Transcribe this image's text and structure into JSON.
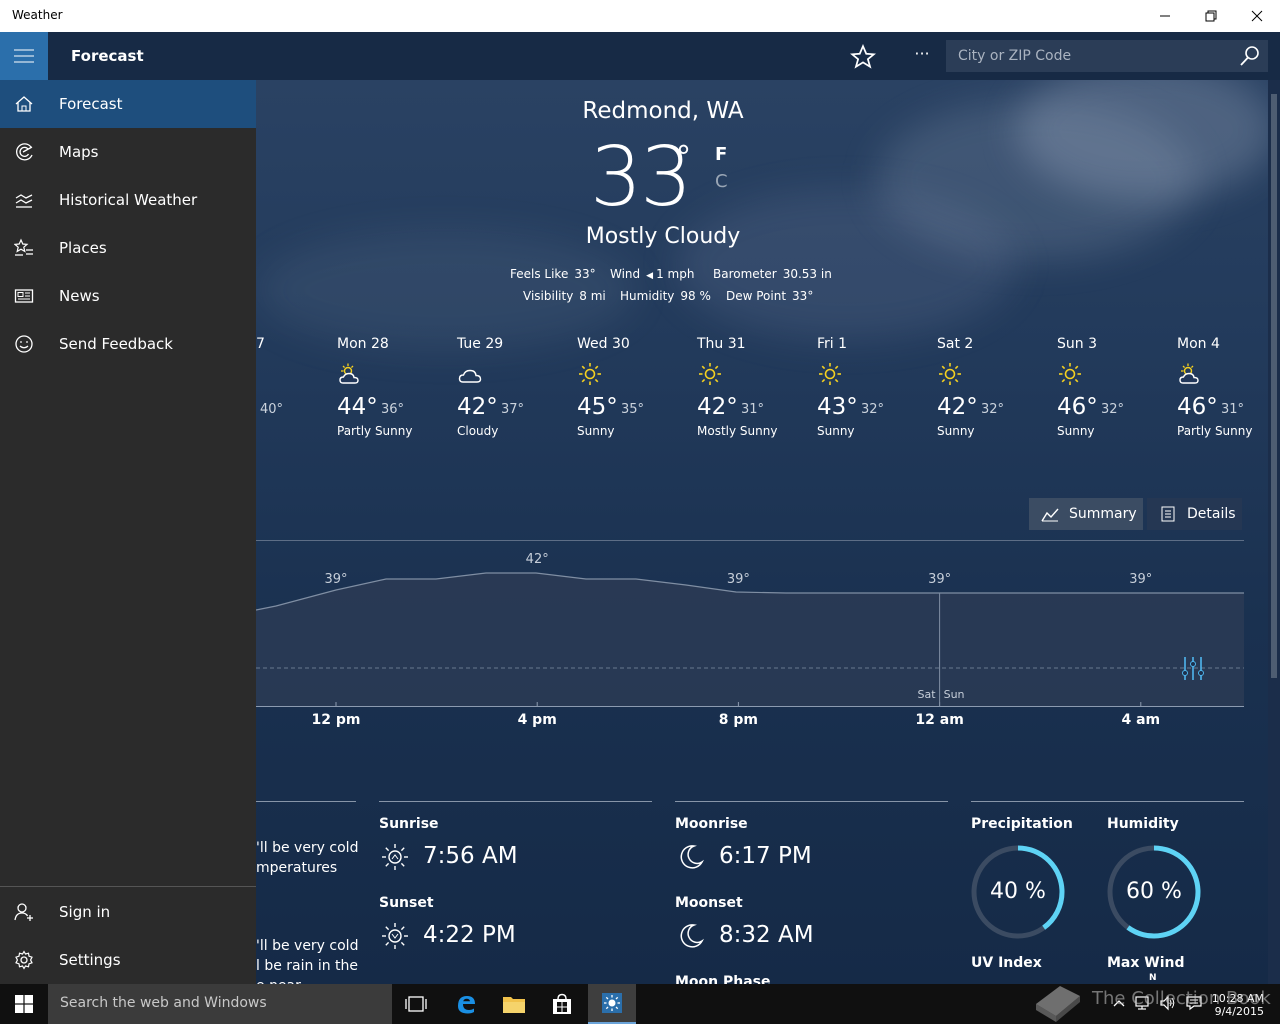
{
  "window": {
    "title": "Weather"
  },
  "appbar": {
    "title": "Forecast",
    "search_placeholder": "City or ZIP Code",
    "more_label": "···"
  },
  "nav": {
    "items": [
      {
        "label": "Forecast",
        "selected": true
      },
      {
        "label": "Maps"
      },
      {
        "label": "Historical Weather"
      },
      {
        "label": "Places"
      },
      {
        "label": "News"
      },
      {
        "label": "Send Feedback"
      }
    ],
    "bottom": [
      {
        "label": "Sign in"
      },
      {
        "label": "Settings"
      }
    ]
  },
  "current": {
    "city": "Redmond, WA",
    "temp": "33",
    "deg": "°",
    "unit_f": "F",
    "unit_c": "C",
    "condition": "Mostly Cloudy",
    "feels_like_label": "Feels Like",
    "feels_like": "33°",
    "wind_label": "Wind",
    "wind": "1 mph",
    "barometer_label": "Barometer",
    "barometer": "30.53 in",
    "visibility_label": "Visibility",
    "visibility": "8 mi",
    "humidity_label": "Humidity",
    "humidity": "98 %",
    "dewpoint_label": "Dew Point",
    "dewpoint": "33°"
  },
  "daily": {
    "partial_day": "7",
    "partial_low": "40°",
    "days": [
      {
        "day": "Mon 28",
        "hi": "44°",
        "lo": "36°",
        "cond": "Partly Sunny",
        "icon": "partly-sunny-icon"
      },
      {
        "day": "Tue 29",
        "hi": "42°",
        "lo": "37°",
        "cond": "Cloudy",
        "icon": "cloudy-icon"
      },
      {
        "day": "Wed 30",
        "hi": "45°",
        "lo": "35°",
        "cond": "Sunny",
        "icon": "sunny-icon"
      },
      {
        "day": "Thu 31",
        "hi": "42°",
        "lo": "31°",
        "cond": "Mostly Sunny",
        "icon": "sunny-icon"
      },
      {
        "day": "Fri 1",
        "hi": "43°",
        "lo": "32°",
        "cond": "Sunny",
        "icon": "sunny-icon"
      },
      {
        "day": "Sat 2",
        "hi": "42°",
        "lo": "32°",
        "cond": "Sunny",
        "icon": "sunny-icon"
      },
      {
        "day": "Sun 3",
        "hi": "46°",
        "lo": "32°",
        "cond": "Sunny",
        "icon": "sunny-icon"
      },
      {
        "day": "Mon 4",
        "hi": "46°",
        "lo": "31°",
        "cond": "Partly Sunny",
        "icon": "partly-sunny-icon"
      }
    ]
  },
  "view_toggle": {
    "summary": "Summary",
    "details": "Details",
    "active": "summary"
  },
  "hourly": {
    "temp_labels": [
      {
        "label": "39°",
        "hour": 12
      },
      {
        "label": "42°",
        "hour": 16
      },
      {
        "label": "39°",
        "hour": 20
      },
      {
        "label": "39°",
        "hour": 24
      },
      {
        "label": "39°",
        "hour": 28
      }
    ],
    "hour_labels": [
      {
        "label": "12 pm",
        "hour": 12
      },
      {
        "label": "4 pm",
        "hour": 16
      },
      {
        "label": "8 pm",
        "hour": 20
      },
      {
        "label": "12 am",
        "hour": 24
      },
      {
        "label": "4 am",
        "hour": 28
      }
    ],
    "day_split": {
      "before": "Sat",
      "after": "Sun",
      "hour": 24
    }
  },
  "day_details": {
    "forecast_fragment_1": [
      "'ll be very cold",
      "mperatures"
    ],
    "forecast_fragment_2": [
      "'ll be very cold",
      "l be rain in the",
      "e near"
    ],
    "sunrise_label": "Sunrise",
    "sunrise": "7:56 AM",
    "sunset_label": "Sunset",
    "sunset": "4:22 PM",
    "moonrise_label": "Moonrise",
    "moonrise": "6:17 PM",
    "moonset_label": "Moonset",
    "moonset": "8:32 AM",
    "moon_phase_label": "Moon Phase",
    "precip_label": "Precipitation",
    "precip": "40 %",
    "precip_value": 0.4,
    "humidity_label": "Humidity",
    "humidity": "60 %",
    "humidity_value": 0.6,
    "uv_label": "UV Index",
    "maxwind_label": "Max Wind",
    "maxwind_dir": "N"
  },
  "taskbar": {
    "search_placeholder": "Search the web and Windows",
    "time": "10:28 AM",
    "date": "9/4/2015"
  },
  "watermark": "The Collection Book",
  "colors": {
    "accent": "#2b6fab",
    "nav_bg": "#2b2b2b",
    "nav_selected": "#1e4e7d",
    "ring": "#5ed3f5",
    "sun": "#f5d020"
  }
}
